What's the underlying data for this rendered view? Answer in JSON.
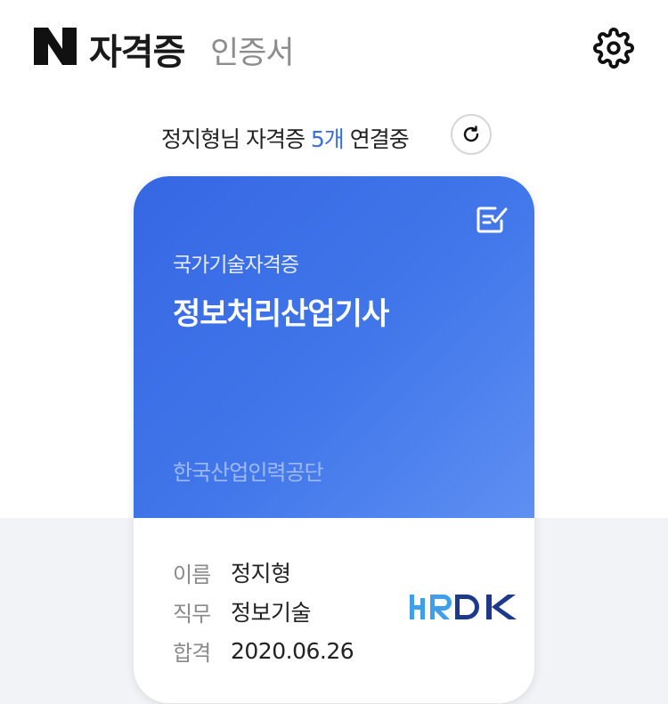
{
  "header": {
    "logo_icon": "naver-n-logo",
    "title": "자격증",
    "subtitle": "인증서",
    "settings_icon": "gear-icon"
  },
  "status": {
    "prefix": "정지형님 자격증 ",
    "count": "5개",
    "suffix": " 연결중",
    "refresh_icon": "refresh-icon"
  },
  "card": {
    "category": "국가기술자격증",
    "name": "정보처리산업기사",
    "issuer": "한국산업인력공단",
    "edit_icon": "edit-note-icon",
    "fields": [
      {
        "label": "이름",
        "value": "정지형"
      },
      {
        "label": "직무",
        "value": "정보기술"
      },
      {
        "label": "합격",
        "value": "2020.06.26"
      }
    ],
    "issuer_logo": "HRDK",
    "colors": {
      "gradient_start": "#3667e4",
      "gradient_end": "#5e8ff2",
      "logo_light": "#3f9fe8",
      "logo_dark": "#1d3a8a"
    }
  },
  "colors": {
    "accent": "#3a6ee0",
    "bottom_background": "#f2f3f7"
  }
}
